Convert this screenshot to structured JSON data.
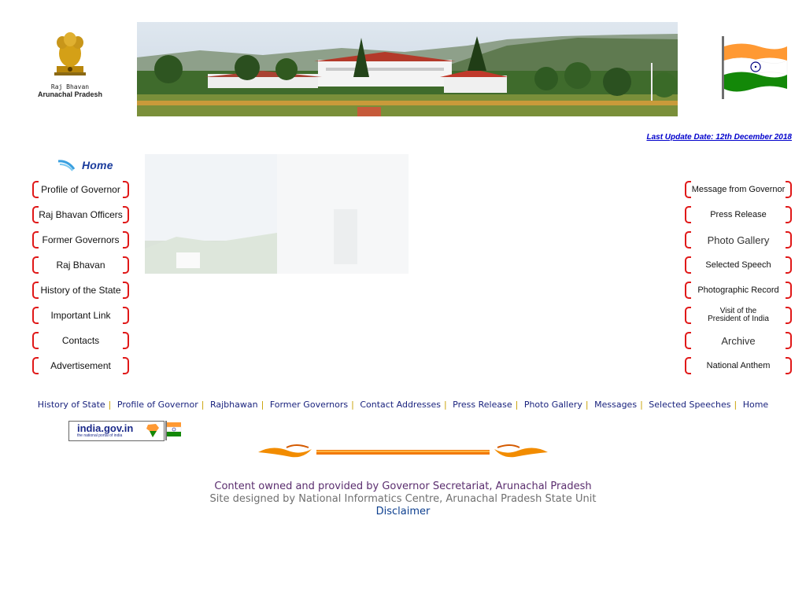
{
  "header": {
    "emblem_line1": "Raj Bhavan",
    "emblem_line2": "Arunachal Pradesh",
    "emblem_motto": "सत्यमेव जयते",
    "last_update": "Last Update Date: 12th December 2018"
  },
  "home_label": "Home",
  "left_nav": [
    {
      "label": "Profile of Governor"
    },
    {
      "label": "Raj Bhavan Officers"
    },
    {
      "label": "Former Governors"
    },
    {
      "label": "Raj Bhavan"
    },
    {
      "label": "History of the State"
    },
    {
      "label": "Important Link"
    },
    {
      "label": "Contacts"
    },
    {
      "label": "Advertisement"
    }
  ],
  "right_nav": [
    {
      "label": "Message from Governor"
    },
    {
      "label": "Press Release"
    },
    {
      "label": "Photo Gallery"
    },
    {
      "label": "Selected Speech"
    },
    {
      "label": "Photographic Record"
    },
    {
      "label": "Visit of the President of India"
    },
    {
      "label": "Archive"
    },
    {
      "label": "National Anthem"
    }
  ],
  "bottom_links": [
    "History of State",
    "Profile of Governor",
    "Rajbhawan",
    "Former Governors",
    "Contact Addresses",
    "Press Release",
    "Photo Gallery",
    "Messages",
    "Selected Speeches",
    "Home"
  ],
  "india_gov": {
    "title": "india.gov.in",
    "tagline": "the national portal of india"
  },
  "footer": {
    "owned": "Content owned and provided by Governor Secretariat, Arunachal Pradesh",
    "designed": "Site designed by National Informatics Centre, Arunachal Pradesh State Unit",
    "disclaimer": "Disclaimer"
  },
  "colors": {
    "bracket_red": "#e01818",
    "link_blue": "#1a237e",
    "separator_gold": "#c8a000"
  }
}
